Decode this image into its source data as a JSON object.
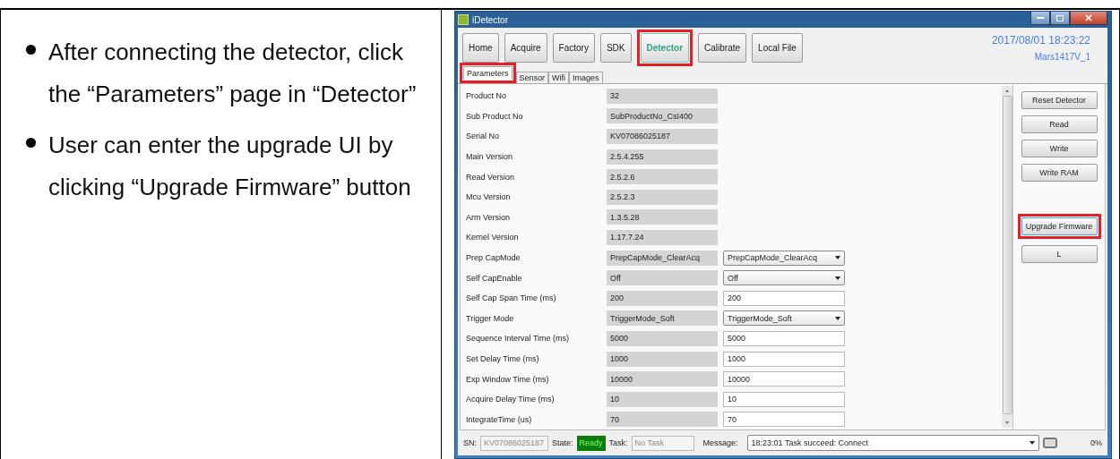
{
  "document": {
    "bullets": [
      "After connecting the detector, click the “Parameters” page in “Detector”",
      "User can enter the upgrade UI by clicking “Upgrade Firmware” button"
    ]
  },
  "window": {
    "title": "iDetector",
    "toolbar": [
      {
        "label": "Home",
        "selected": false,
        "highlighted": false
      },
      {
        "label": "Acquire",
        "selected": false,
        "highlighted": false
      },
      {
        "label": "Factory",
        "selected": false,
        "highlighted": false
      },
      {
        "label": "SDK",
        "selected": false,
        "highlighted": false
      },
      {
        "label": "Detector",
        "selected": true,
        "highlighted": true
      },
      {
        "label": "Calibrate",
        "selected": false,
        "highlighted": false
      },
      {
        "label": "Local File",
        "selected": false,
        "highlighted": false
      }
    ],
    "datetime": "2017/08/01 18:23:22",
    "model": "Mars1417V_1",
    "tabs": [
      {
        "label": "Parameters",
        "selected": true,
        "highlighted": true
      },
      {
        "label": "Sensor",
        "selected": false,
        "highlighted": false
      },
      {
        "label": "Wifi",
        "selected": false,
        "highlighted": false
      },
      {
        "label": "Images",
        "selected": false,
        "highlighted": false
      }
    ],
    "rows": [
      {
        "label": "Product No",
        "kind": "readonly",
        "value": "32"
      },
      {
        "label": "Sub Product No",
        "kind": "readonly",
        "value": "SubProductNo_CsI400"
      },
      {
        "label": "Serial No",
        "kind": "readonly",
        "value": "KV07086025187"
      },
      {
        "label": "Main Version",
        "kind": "readonly",
        "value": "2.5.4.255"
      },
      {
        "label": "Read Version",
        "kind": "readonly",
        "value": "2.5.2.6"
      },
      {
        "label": "Mcu Version",
        "kind": "readonly",
        "value": "2.5.2.3"
      },
      {
        "label": "Arm Version",
        "kind": "readonly",
        "value": "1.3.5.28"
      },
      {
        "label": "Kernel Version",
        "kind": "readonly",
        "value": "1.17.7.24"
      },
      {
        "label": "Prep CapMode",
        "kind": "select",
        "value": "PrepCapMode_ClearAcq",
        "edit": "PrepCapMode_ClearAcq"
      },
      {
        "label": "Self CapEnable",
        "kind": "select",
        "value": "Off",
        "edit": "Off"
      },
      {
        "label": "Self Cap Span Time (ms)",
        "kind": "input",
        "value": "200",
        "edit": "200"
      },
      {
        "label": "Trigger Mode",
        "kind": "select",
        "value": "TriggerMode_Soft",
        "edit": "TriggerMode_Soft"
      },
      {
        "label": "Sequence Interval Time (ms)",
        "kind": "input",
        "value": "5000",
        "edit": "5000"
      },
      {
        "label": "Set Delay Time (ms)",
        "kind": "input",
        "value": "1000",
        "edit": "1000"
      },
      {
        "label": "Exp Window Time (ms)",
        "kind": "input",
        "value": "10000",
        "edit": "10000"
      },
      {
        "label": "Acquire Delay Time (ms)",
        "kind": "input",
        "value": "10",
        "edit": "10"
      },
      {
        "label": "IntegrateTime (us)",
        "kind": "input",
        "value": "70",
        "edit": "70"
      }
    ],
    "actions": [
      {
        "label": "Reset Detector",
        "highlighted": false
      },
      {
        "label": "Read",
        "highlighted": false
      },
      {
        "label": "Write",
        "highlighted": false
      },
      {
        "label": "Write RAM",
        "highlighted": false
      },
      {
        "label": "Upgrade Firmware",
        "highlighted": true
      },
      {
        "label": "L",
        "highlighted": false
      }
    ],
    "status": {
      "sn_label": "SN:",
      "sn": "KV07086025187",
      "state_label": "State:",
      "state": "Ready",
      "task_label": "Task:",
      "task": "No Task",
      "message_label": "Message:",
      "message": "18:23:01 Task succeed: Connect",
      "progress": "0%"
    }
  }
}
